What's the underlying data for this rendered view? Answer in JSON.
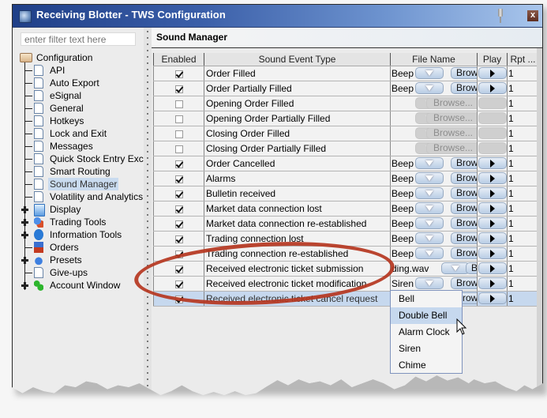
{
  "window": {
    "title": "Receiving Blotter - TWS Configuration",
    "close_label": "x"
  },
  "sidebar": {
    "filter_placeholder": "enter filter text here",
    "root": {
      "label": "Configuration",
      "icon": "folder-open-icon"
    },
    "items": [
      {
        "label": "API",
        "icon": "document-icon",
        "expandable": false
      },
      {
        "label": "Auto Export",
        "icon": "document-icon",
        "expandable": false
      },
      {
        "label": "eSignal",
        "icon": "document-icon",
        "expandable": false
      },
      {
        "label": "General",
        "icon": "document-icon",
        "expandable": false
      },
      {
        "label": "Hotkeys",
        "icon": "document-icon",
        "expandable": false
      },
      {
        "label": "Lock and Exit",
        "icon": "document-icon",
        "expandable": false
      },
      {
        "label": "Messages",
        "icon": "document-icon",
        "expandable": false
      },
      {
        "label": "Quick Stock Entry Exc",
        "icon": "document-icon",
        "expandable": false
      },
      {
        "label": "Smart Routing",
        "icon": "document-icon",
        "expandable": false
      },
      {
        "label": "Sound Manager",
        "icon": "document-icon",
        "expandable": false,
        "selected": true
      },
      {
        "label": "Volatility and Analytics",
        "icon": "document-icon",
        "expandable": false
      },
      {
        "label": "Display",
        "icon": "display-icon",
        "expandable": true
      },
      {
        "label": "Trading Tools",
        "icon": "trading-tools-icon",
        "expandable": true
      },
      {
        "label": "Information Tools",
        "icon": "info-icon",
        "expandable": true
      },
      {
        "label": "Orders",
        "icon": "orders-icon",
        "expandable": false
      },
      {
        "label": "Presets",
        "icon": "presets-icon",
        "expandable": true
      },
      {
        "label": "Give-ups",
        "icon": "document-icon",
        "expandable": false
      },
      {
        "label": "Account Window",
        "icon": "account-window-icon",
        "expandable": true
      }
    ]
  },
  "panel": {
    "title": "Sound Manager"
  },
  "table": {
    "columns": [
      "Enabled",
      "Sound Event Type",
      "File Name",
      "Play",
      "Rpt ..."
    ],
    "browse_label": "Browse...",
    "browse_short": "Brow",
    "browse_tiny": "B",
    "rows": [
      {
        "enabled": true,
        "event": "Order Filled",
        "file": "Beep",
        "rpt": "1"
      },
      {
        "enabled": true,
        "event": "Order Partially Filled",
        "file": "Beep",
        "rpt": "1"
      },
      {
        "enabled": false,
        "event": "Opening Order Filled",
        "file": "",
        "rpt": "1"
      },
      {
        "enabled": false,
        "event": "Opening Order Partially Filled",
        "file": "",
        "rpt": "1"
      },
      {
        "enabled": false,
        "event": "Closing Order Filled",
        "file": "",
        "rpt": "1"
      },
      {
        "enabled": false,
        "event": "Closing Order Partially Filled",
        "file": "",
        "rpt": "1"
      },
      {
        "enabled": true,
        "event": "Order Cancelled",
        "file": "Beep",
        "rpt": "1"
      },
      {
        "enabled": true,
        "event": "Alarms",
        "file": "Beep",
        "rpt": "1"
      },
      {
        "enabled": true,
        "event": "Bulletin received",
        "file": "Beep",
        "rpt": "1"
      },
      {
        "enabled": true,
        "event": "Market data connection lost",
        "file": "Beep",
        "rpt": "1"
      },
      {
        "enabled": true,
        "event": "Market data connection re-established",
        "file": "Beep",
        "rpt": "1"
      },
      {
        "enabled": true,
        "event": "Trading connection lost",
        "file": "Beep",
        "rpt": "1"
      },
      {
        "enabled": true,
        "event": "Trading connection re-established",
        "file": "Beep",
        "rpt": "1"
      },
      {
        "enabled": true,
        "event": "Received electronic ticket submission",
        "file": "ding.wav",
        "rpt": "1"
      },
      {
        "enabled": true,
        "event": "Received electronic ticket modification",
        "file": "Siren",
        "rpt": "1"
      },
      {
        "enabled": true,
        "event": "Received electronic ticket cancel request",
        "file": "",
        "rpt": "1",
        "selected": true
      }
    ]
  },
  "dropdown": {
    "options": [
      "Bell",
      "Double Bell",
      "Alarm Clock",
      "Siren",
      "Chime"
    ],
    "highlighted": "Double Bell"
  },
  "annotation": {
    "color": "#b5361f",
    "shape": "ellipse"
  }
}
